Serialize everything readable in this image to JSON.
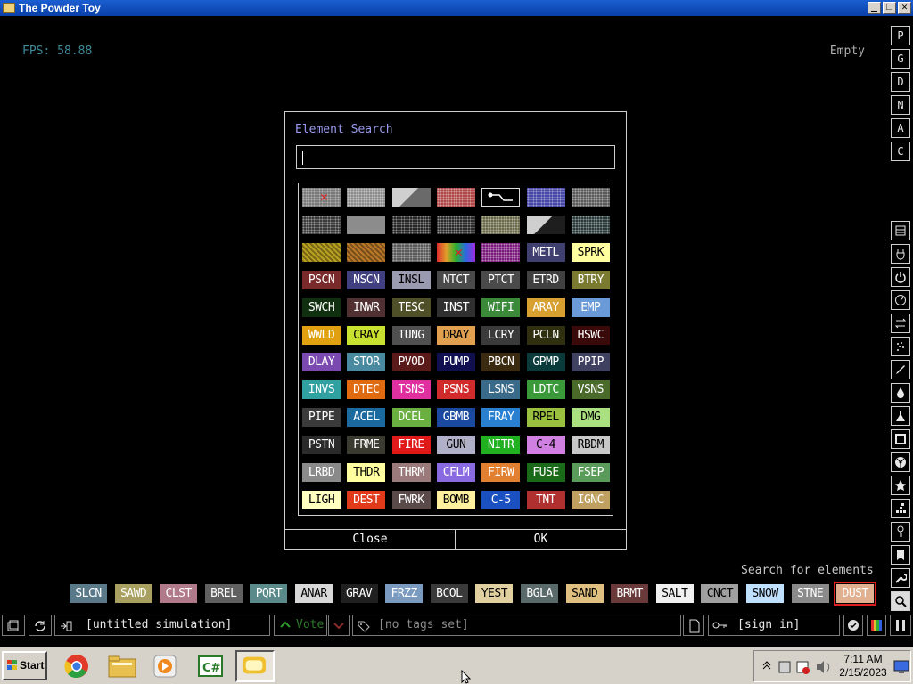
{
  "window": {
    "title": "The Powder Toy"
  },
  "hud": {
    "fps": "FPS: 58.88",
    "hover": "Empty"
  },
  "right_toolbar_top": [
    "P",
    "G",
    "D",
    "N",
    "A",
    "C"
  ],
  "right_toolbar_icons": [
    "save-icon",
    "plug-icon",
    "power-icon",
    "gauge-icon",
    "arrows-icon",
    "spray-icon",
    "pen-icon",
    "drop-icon",
    "flask-icon",
    "square-icon",
    "radiation-icon",
    "star-icon",
    "dots-icon",
    "key-icon",
    "bookmark-icon",
    "wrench-icon",
    "magnifier-icon"
  ],
  "dialog": {
    "title": "Element Search",
    "search_value": "",
    "close_label": "Close",
    "ok_label": "OK"
  },
  "elements": [
    [
      {
        "t": "",
        "bg": "#7a7a7a",
        "fg": "#fff",
        "icon": "erase"
      },
      {
        "t": "",
        "bg": "#8c8c8c",
        "fg": "#fff",
        "icon": "dots"
      },
      {
        "t": "",
        "bg": "#6a6a6a",
        "fg": "#fff",
        "icon": "tri"
      },
      {
        "t": "",
        "bg": "#b04848",
        "fg": "#fff",
        "icon": "dots"
      },
      {
        "t": "",
        "bg": "#000",
        "fg": "#fff",
        "icon": "wire"
      },
      {
        "t": "",
        "bg": "#4848a8",
        "fg": "#fff",
        "icon": "dots"
      },
      {
        "t": "",
        "bg": "#5a5a5a",
        "fg": "#fff",
        "icon": "dots"
      }
    ],
    [
      {
        "t": "",
        "bg": "#3a3a3a",
        "fg": "#fff",
        "icon": "dots"
      },
      {
        "t": "",
        "bg": "#8c8c8c",
        "fg": "#fff",
        "icon": ""
      },
      {
        "t": "",
        "bg": "#262626",
        "fg": "#fff",
        "icon": "dots"
      },
      {
        "t": "",
        "bg": "#2a2a2a",
        "fg": "#fff",
        "icon": "dots"
      },
      {
        "t": "",
        "bg": "#6a6a4a",
        "fg": "#fff",
        "icon": "dots"
      },
      {
        "t": "",
        "bg": "#1e1e1e",
        "fg": "#fff",
        "icon": "tri"
      },
      {
        "t": "",
        "bg": "#2a3a3a",
        "fg": "#fff",
        "icon": "dots"
      }
    ],
    [
      {
        "t": "",
        "bg": "#b8a020",
        "fg": "#fff",
        "icon": "hatch"
      },
      {
        "t": "",
        "bg": "#b87828",
        "fg": "#fff",
        "icon": "hatch"
      },
      {
        "t": "",
        "bg": "#5a5a5a",
        "fg": "#fff",
        "icon": "dots"
      },
      {
        "t": "",
        "bg": "#7a2aa8",
        "fg": "#fff",
        "icon": "rainbow"
      },
      {
        "t": "",
        "bg": "#7a1a7a",
        "fg": "#fff",
        "icon": "dots"
      },
      {
        "t": "METL",
        "bg": "#404070",
        "fg": "#fff",
        "icon": ""
      },
      {
        "t": "SPRK",
        "bg": "#ffffa0",
        "fg": "#000",
        "icon": ""
      }
    ],
    [
      {
        "t": "PSCN",
        "bg": "#7a2a2a",
        "fg": "#fff",
        "icon": ""
      },
      {
        "t": "NSCN",
        "bg": "#404080",
        "fg": "#fff",
        "icon": ""
      },
      {
        "t": "INSL",
        "bg": "#9a9ab0",
        "fg": "#000",
        "icon": ""
      },
      {
        "t": "NTCT",
        "bg": "#4a4a4a",
        "fg": "#fff",
        "icon": ""
      },
      {
        "t": "PTCT",
        "bg": "#4a4a4a",
        "fg": "#fff",
        "icon": ""
      },
      {
        "t": "ETRD",
        "bg": "#404040",
        "fg": "#fff",
        "icon": ""
      },
      {
        "t": "BTRY",
        "bg": "#7a7a30",
        "fg": "#fff",
        "icon": ""
      }
    ],
    [
      {
        "t": "SWCH",
        "bg": "#103010",
        "fg": "#fff",
        "icon": ""
      },
      {
        "t": "INWR",
        "bg": "#503030",
        "fg": "#fff",
        "icon": ""
      },
      {
        "t": "TESC",
        "bg": "#505028",
        "fg": "#fff",
        "icon": ""
      },
      {
        "t": "INST",
        "bg": "#303030",
        "fg": "#fff",
        "icon": ""
      },
      {
        "t": "WIFI",
        "bg": "#3a8a3a",
        "fg": "#fff",
        "icon": ""
      },
      {
        "t": "ARAY",
        "bg": "#d8a030",
        "fg": "#fff",
        "icon": ""
      },
      {
        "t": "EMP",
        "bg": "#6a9ad8",
        "fg": "#fff",
        "icon": ""
      }
    ],
    [
      {
        "t": "WWLD",
        "bg": "#e0a010",
        "fg": "#fff",
        "icon": ""
      },
      {
        "t": "CRAY",
        "bg": "#c8e030",
        "fg": "#000",
        "icon": ""
      },
      {
        "t": "TUNG",
        "bg": "#505050",
        "fg": "#fff",
        "icon": ""
      },
      {
        "t": "DRAY",
        "bg": "#e0a050",
        "fg": "#000",
        "icon": ""
      },
      {
        "t": "LCRY",
        "bg": "#3a3a3a",
        "fg": "#fff",
        "icon": ""
      },
      {
        "t": "PCLN",
        "bg": "#303010",
        "fg": "#fff",
        "icon": ""
      },
      {
        "t": "HSWC",
        "bg": "#3a0a0a",
        "fg": "#fff",
        "icon": ""
      }
    ],
    [
      {
        "t": "DLAY",
        "bg": "#7a4ab0",
        "fg": "#fff",
        "icon": ""
      },
      {
        "t": "STOR",
        "bg": "#4a8aa0",
        "fg": "#fff",
        "icon": ""
      },
      {
        "t": "PVOD",
        "bg": "#5a1a1a",
        "fg": "#fff",
        "icon": ""
      },
      {
        "t": "PUMP",
        "bg": "#101050",
        "fg": "#fff",
        "icon": ""
      },
      {
        "t": "PBCN",
        "bg": "#3a2a10",
        "fg": "#fff",
        "icon": ""
      },
      {
        "t": "GPMP",
        "bg": "#0a3a3a",
        "fg": "#fff",
        "icon": ""
      },
      {
        "t": "PPIP",
        "bg": "#404060",
        "fg": "#fff",
        "icon": ""
      }
    ],
    [
      {
        "t": "INVS",
        "bg": "#30a0a0",
        "fg": "#fff",
        "icon": ""
      },
      {
        "t": "DTEC",
        "bg": "#e06a10",
        "fg": "#fff",
        "icon": ""
      },
      {
        "t": "TSNS",
        "bg": "#e030a0",
        "fg": "#fff",
        "icon": ""
      },
      {
        "t": "PSNS",
        "bg": "#d02a2a",
        "fg": "#fff",
        "icon": ""
      },
      {
        "t": "LSNS",
        "bg": "#3a6a8a",
        "fg": "#fff",
        "icon": ""
      },
      {
        "t": "LDTC",
        "bg": "#3a9a3a",
        "fg": "#fff",
        "icon": ""
      },
      {
        "t": "VSNS",
        "bg": "#4a6a2a",
        "fg": "#fff",
        "icon": ""
      }
    ],
    [
      {
        "t": "PIPE",
        "bg": "#3a3a3a",
        "fg": "#fff",
        "icon": ""
      },
      {
        "t": "ACEL",
        "bg": "#1a6aa0",
        "fg": "#fff",
        "icon": ""
      },
      {
        "t": "DCEL",
        "bg": "#6ab040",
        "fg": "#fff",
        "icon": ""
      },
      {
        "t": "GBMB",
        "bg": "#1a4aa0",
        "fg": "#fff",
        "icon": ""
      },
      {
        "t": "FRAY",
        "bg": "#2a80d0",
        "fg": "#fff",
        "icon": ""
      },
      {
        "t": "RPEL",
        "bg": "#9ac040",
        "fg": "#000",
        "icon": ""
      },
      {
        "t": "DMG",
        "bg": "#aae080",
        "fg": "#000",
        "icon": ""
      }
    ],
    [
      {
        "t": "PSTN",
        "bg": "#2a2a2a",
        "fg": "#fff",
        "icon": ""
      },
      {
        "t": "FRME",
        "bg": "#3a3a30",
        "fg": "#fff",
        "icon": ""
      },
      {
        "t": "FIRE",
        "bg": "#e01a1a",
        "fg": "#fff",
        "icon": ""
      },
      {
        "t": "GUN",
        "bg": "#b0b0c8",
        "fg": "#000",
        "icon": ""
      },
      {
        "t": "NITR",
        "bg": "#20b020",
        "fg": "#fff",
        "icon": ""
      },
      {
        "t": "C-4",
        "bg": "#d080e0",
        "fg": "#000",
        "icon": ""
      },
      {
        "t": "RBDM",
        "bg": "#c8c8c8",
        "fg": "#000",
        "icon": ""
      }
    ],
    [
      {
        "t": "LRBD",
        "bg": "#8a8a8a",
        "fg": "#fff",
        "icon": ""
      },
      {
        "t": "THDR",
        "bg": "#ffffa0",
        "fg": "#000",
        "icon": ""
      },
      {
        "t": "THRM",
        "bg": "#9a7a7a",
        "fg": "#fff",
        "icon": ""
      },
      {
        "t": "CFLM",
        "bg": "#8a6ae0",
        "fg": "#fff",
        "icon": ""
      },
      {
        "t": "FIRW",
        "bg": "#e08030",
        "fg": "#fff",
        "icon": ""
      },
      {
        "t": "FUSE",
        "bg": "#1a6a1a",
        "fg": "#fff",
        "icon": ""
      },
      {
        "t": "FSEP",
        "bg": "#5a9a5a",
        "fg": "#fff",
        "icon": ""
      }
    ],
    [
      {
        "t": "LIGH",
        "bg": "#ffffc0",
        "fg": "#000",
        "icon": ""
      },
      {
        "t": "DEST",
        "bg": "#e03a1a",
        "fg": "#fff",
        "icon": ""
      },
      {
        "t": "FWRK",
        "bg": "#5a4a4a",
        "fg": "#fff",
        "icon": ""
      },
      {
        "t": "BOMB",
        "bg": "#fff0a0",
        "fg": "#000",
        "icon": ""
      },
      {
        "t": "C-5",
        "bg": "#1a50c0",
        "fg": "#fff",
        "icon": ""
      },
      {
        "t": "TNT",
        "bg": "#b03030",
        "fg": "#fff",
        "icon": ""
      },
      {
        "t": "IGNC",
        "bg": "#c0a060",
        "fg": "#fff",
        "icon": ""
      }
    ]
  ],
  "search_label": "Search for elements",
  "bottom_elements": [
    {
      "t": "SLCN",
      "bg": "#5a7a8a",
      "fg": "#fff"
    },
    {
      "t": "SAWD",
      "bg": "#a8a060",
      "fg": "#fff"
    },
    {
      "t": "CLST",
      "bg": "#b07a8a",
      "fg": "#fff"
    },
    {
      "t": "BREL",
      "bg": "#606060",
      "fg": "#fff"
    },
    {
      "t": "PQRT",
      "bg": "#5a8a8a",
      "fg": "#fff"
    },
    {
      "t": "ANAR",
      "bg": "#d8d8d8",
      "fg": "#000"
    },
    {
      "t": "GRAV",
      "bg": "#202020",
      "fg": "#fff"
    },
    {
      "t": "FRZZ",
      "bg": "#7a9ac0",
      "fg": "#fff"
    },
    {
      "t": "BCOL",
      "bg": "#3a3a3a",
      "fg": "#fff"
    },
    {
      "t": "YEST",
      "bg": "#e0d0a0",
      "fg": "#000"
    },
    {
      "t": "BGLA",
      "bg": "#5a6a6a",
      "fg": "#fff"
    },
    {
      "t": "SAND",
      "bg": "#e0c080",
      "fg": "#000"
    },
    {
      "t": "BRMT",
      "bg": "#6a3a3a",
      "fg": "#fff"
    },
    {
      "t": "SALT",
      "bg": "#f0f0f0",
      "fg": "#000"
    },
    {
      "t": "CNCT",
      "bg": "#a0a0a0",
      "fg": "#000"
    },
    {
      "t": "SNOW",
      "bg": "#c0e0ff",
      "fg": "#000"
    },
    {
      "t": "STNE",
      "bg": "#8a8a8a",
      "fg": "#fff"
    },
    {
      "t": "DUST",
      "bg": "#e0b090",
      "fg": "#fff"
    }
  ],
  "statusbar": {
    "sim_name": "[untitled simulation]",
    "vote_label": "Vote",
    "tags": "[no tags set]",
    "signin": "[sign in]"
  },
  "taskbar": {
    "start_label": "Start",
    "clock_time": "7:11 AM",
    "clock_date": "2/15/2023"
  }
}
